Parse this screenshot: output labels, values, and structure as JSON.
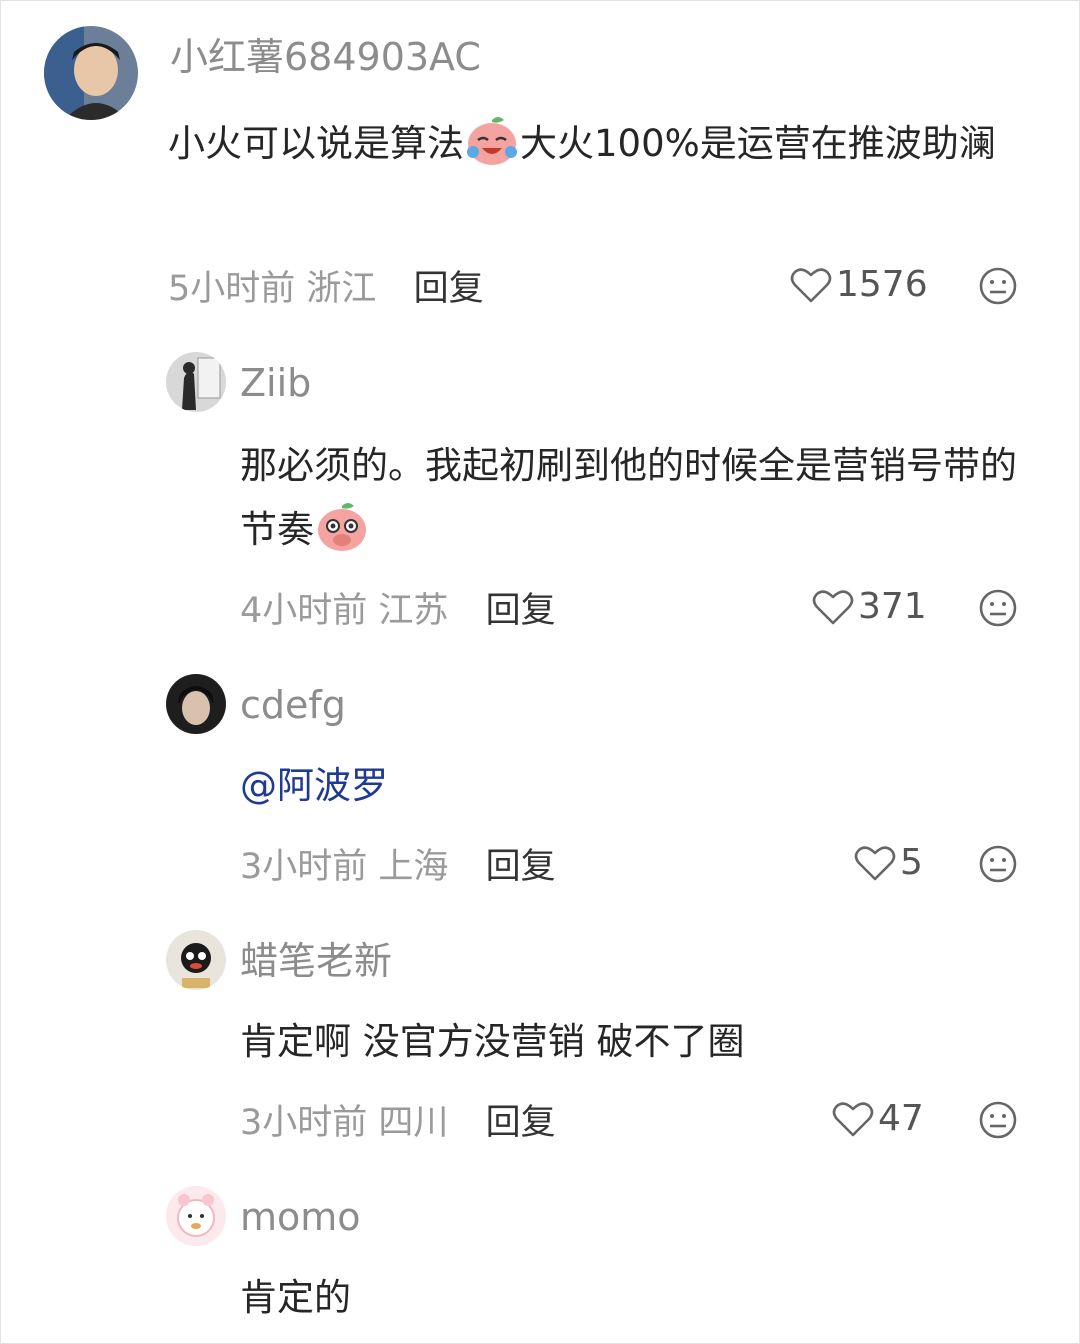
{
  "comments": [
    {
      "user": "小红薯684903AC",
      "text_before": "小火可以说是算法",
      "emoji": "crying-laugh-peach-emoji",
      "text_after": "大火100%是运营在推波助澜",
      "time": "5小时前",
      "location": "浙江",
      "reply": "回复",
      "likes": "1576"
    },
    {
      "user": "Ziib",
      "text_before": "那必须的。我起初刷到他的时候全是营销号带的节奏",
      "emoji": "covering-mouth-peach-emoji",
      "time": "4小时前",
      "location": "江苏",
      "reply": "回复",
      "likes": "371"
    },
    {
      "user": "cdefg",
      "mention": "@阿波罗",
      "time": "3小时前",
      "location": "上海",
      "reply": "回复",
      "likes": "5"
    },
    {
      "user": "蜡笔老新",
      "text": "肯定啊 没官方没营销 破不了圈",
      "time": "3小时前",
      "location": "四川",
      "reply": "回复",
      "likes": "47"
    },
    {
      "user": "momo",
      "text": "肯定的"
    }
  ],
  "icons": {
    "like": "heart-outline-icon",
    "dislike": "meh-face-icon"
  },
  "colors": {
    "mention": "#1f3a93",
    "username": "#8c8c8c",
    "meta": "#9a9a9a"
  }
}
